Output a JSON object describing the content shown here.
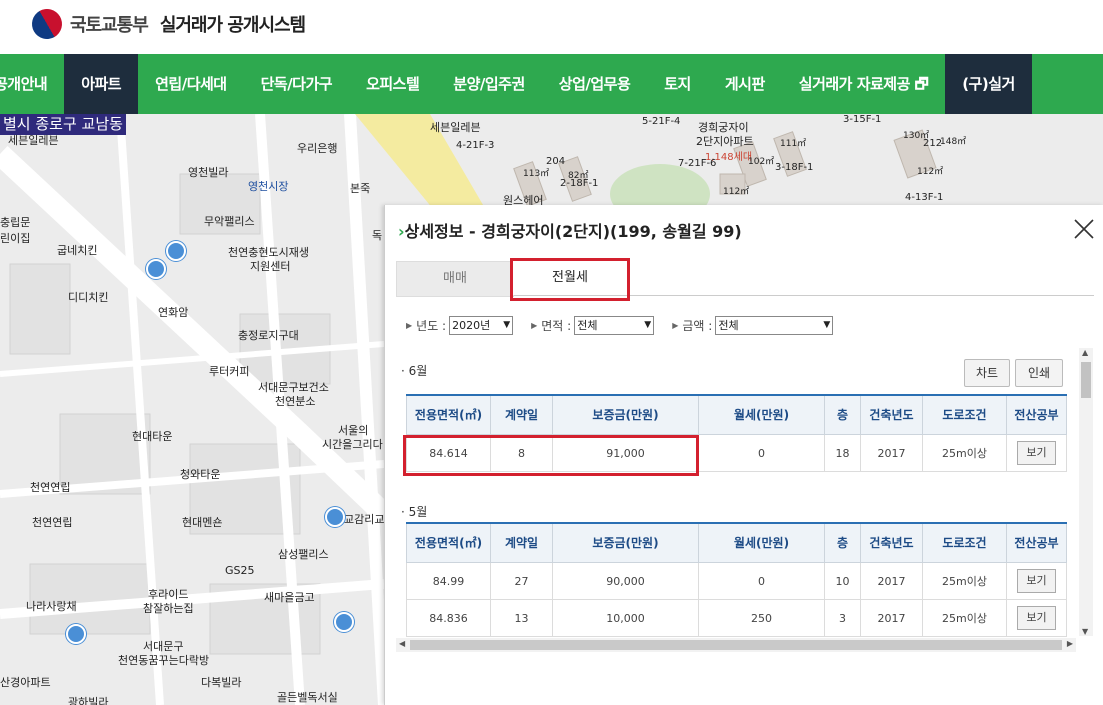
{
  "header": {
    "ministry": "국토교통부",
    "system_name": "실거래가 공개시스템"
  },
  "nav": {
    "items": [
      "공개안내",
      "아파트",
      "연립/다세대",
      "단독/다가구",
      "오피스텔",
      "분양/입주권",
      "상업/업무용",
      "토지",
      "게시판",
      "실거래가 자료제공 🗗",
      "(구)실거"
    ],
    "active_index": 1
  },
  "map": {
    "location": "별시 종로구 교남동",
    "labels": [
      "세븐일레븐",
      "우리은행",
      "영천빌라",
      "영천시장",
      "본죽",
      "무악팰리스",
      "굽네치킨",
      "천연충현도시재생",
      "지원센터",
      "디디치킨",
      "연화암",
      "충정로지구대",
      "루터커피",
      "서대문구보건소",
      "천연분소",
      "서울의",
      "시간을그리다",
      "현대타운",
      "청와타운",
      "천연연립",
      "천연연립",
      "현대멘숀",
      "교감리교",
      "삼성팰리스",
      "GS25",
      "후라이드",
      "참잘하는집",
      "새마을금고",
      "나라사랑채",
      "서대문구",
      "천연동꿈꾸는다락방",
      "다복빌라",
      "산경아파트",
      "광하빌라",
      "골든벨독서실",
      "원스헤어",
      "세븐일레븐",
      "경희궁자이",
      "2단지아파트",
      "1,148세대",
      "4-21F-3",
      "5-21F-4",
      "7-21F-6",
      "3-18F-1",
      "2-18F-1",
      "4-13F-1",
      "3-15F-1",
      "113㎡",
      "204",
      "82㎡",
      "111㎡",
      "102㎡",
      "112㎡",
      "130㎡",
      "212",
      "148㎡",
      "112㎡",
      "충립문",
      "린이집",
      "독"
    ]
  },
  "panel": {
    "title": "상세정보 - 경희궁자이(2단지)(199, 송월길 99)",
    "tabs": [
      "매매",
      "전월세"
    ],
    "active_tab": "전월세",
    "filters": {
      "year_label": "년도 :",
      "year_value": "2020년",
      "area_label": "면적 :",
      "area_value": "전체",
      "price_label": "금액 :",
      "price_value": "전체"
    },
    "buttons": {
      "chart": "차트",
      "print": "인쇄"
    },
    "columns": [
      "전용면적(㎡)",
      "계약일",
      "보증금(만원)",
      "월세(만원)",
      "층",
      "건축년도",
      "도로조건",
      "전산공부"
    ],
    "months": [
      {
        "label": "· 6월",
        "rows": [
          {
            "area": "84.614",
            "day": "8",
            "deposit": "91,000",
            "rent": "0",
            "floor": "18",
            "year": "2017",
            "road": "25m이상",
            "view": "보기"
          }
        ]
      },
      {
        "label": "· 5월",
        "rows": [
          {
            "area": "84.99",
            "day": "27",
            "deposit": "90,000",
            "rent": "0",
            "floor": "10",
            "year": "2017",
            "road": "25m이상",
            "view": "보기"
          },
          {
            "area": "84.836",
            "day": "13",
            "deposit": "10,000",
            "rent": "250",
            "floor": "3",
            "year": "2017",
            "road": "25m이상",
            "view": "보기"
          }
        ]
      }
    ]
  }
}
